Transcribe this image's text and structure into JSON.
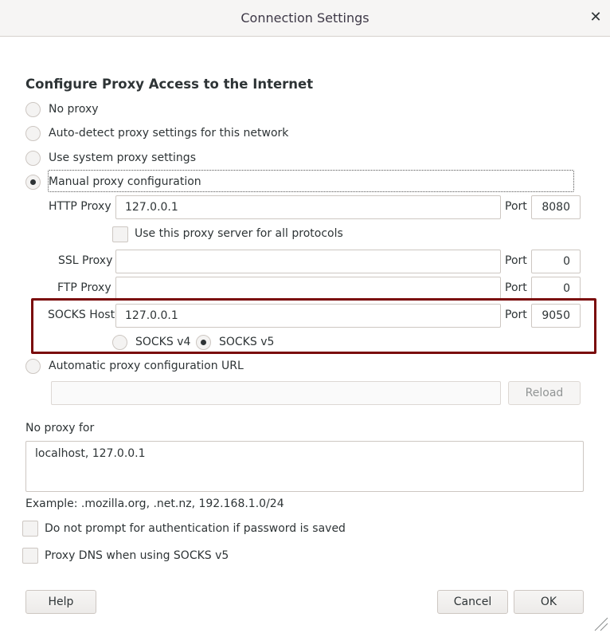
{
  "window": {
    "title": "Connection Settings",
    "close_glyph": "✕"
  },
  "heading": "Configure Proxy Access to the Internet",
  "proxy_options": [
    {
      "label": "No proxy",
      "checked": false
    },
    {
      "label": "Auto-detect proxy settings for this network",
      "checked": false
    },
    {
      "label": "Use system proxy settings",
      "checked": false
    },
    {
      "label": "Manual proxy configuration",
      "checked": true
    }
  ],
  "http": {
    "label": "HTTP Proxy",
    "host": "127.0.0.1",
    "port_label": "Port",
    "port": "8080"
  },
  "use_all_protocols": {
    "label": "Use this proxy server for all protocols",
    "checked": false
  },
  "ssl": {
    "label": "SSL Proxy",
    "host": "",
    "port_label": "Port",
    "port": "0"
  },
  "ftp": {
    "label": "FTP Proxy",
    "host": "",
    "port_label": "Port",
    "port": "0"
  },
  "socks": {
    "label": "SOCKS Host",
    "host": "127.0.0.1",
    "port_label": "Port",
    "port": "9050",
    "v4_label": "SOCKS v4",
    "v5_label": "SOCKS v5",
    "selected": "v5"
  },
  "auto_config": {
    "label": "Automatic proxy configuration URL",
    "url": "",
    "reload_label": "Reload",
    "checked": false
  },
  "no_proxy": {
    "label": "No proxy for",
    "value": "localhost, 127.0.0.1",
    "example": "Example: .mozilla.org, .net.nz, 192.168.1.0/24"
  },
  "no_auth_prompt": {
    "label": "Do not prompt for authentication if password is saved",
    "checked": false
  },
  "proxy_dns": {
    "label": "Proxy DNS when using SOCKS v5",
    "checked": false
  },
  "buttons": {
    "help": "Help",
    "cancel": "Cancel",
    "ok": "OK"
  },
  "colors": {
    "highlight_border": "#7a0a0a",
    "titlebar_bg": "#f6f5f4"
  }
}
